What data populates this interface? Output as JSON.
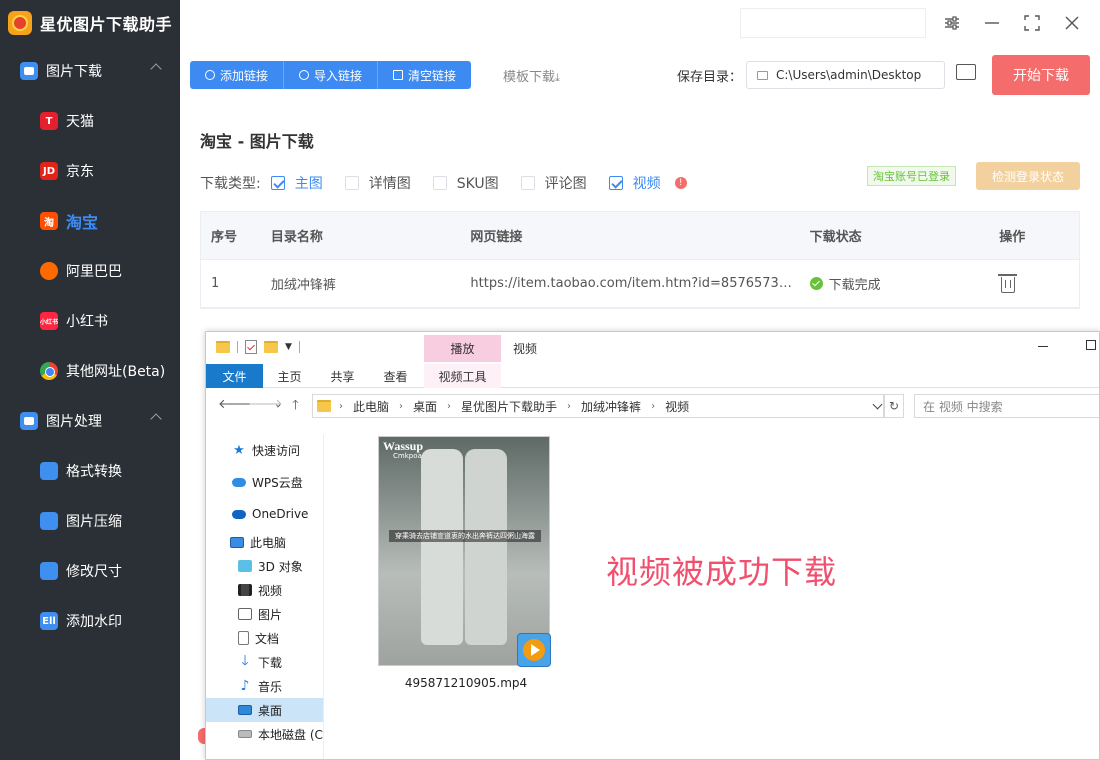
{
  "app": {
    "title": "星优图片下载助手",
    "accent": "#3d8bf2",
    "sidebar_bg": "#2b3036"
  },
  "sidebar": {
    "groups": [
      {
        "label": "图片下载",
        "items": [
          {
            "label": "天猫",
            "icon_text": "T"
          },
          {
            "label": "京东",
            "icon_text": "JD"
          },
          {
            "label": "淘宝",
            "icon_text": "淘"
          },
          {
            "label": "阿里巴巴",
            "icon_text": ""
          },
          {
            "label": "小红书",
            "icon_text": "小红书"
          },
          {
            "label": "其他网址(Beta)",
            "icon_text": ""
          }
        ]
      },
      {
        "label": "图片处理",
        "items": [
          {
            "label": "格式转换"
          },
          {
            "label": "图片压缩"
          },
          {
            "label": "修改尺寸"
          },
          {
            "label": "添加水印",
            "icon_text": "Ell"
          }
        ]
      }
    ]
  },
  "toolbar": {
    "add_link": "添加链接",
    "import_link": "导入链接",
    "clear_link": "清空链接",
    "template_download": "模板下载",
    "save_dir_label": "保存目录：",
    "save_dir_value": "C:\\Users\\admin\\Desktop",
    "start_download": "开始下载"
  },
  "content": {
    "title": "淘宝 - 图片下载",
    "type_label": "下载类型:",
    "types": [
      {
        "label": "主图",
        "checked": true
      },
      {
        "label": "详情图",
        "checked": false
      },
      {
        "label": "SKU图",
        "checked": false
      },
      {
        "label": "评论图",
        "checked": false
      },
      {
        "label": "视频",
        "checked": true
      }
    ],
    "info_mark": "!",
    "login_status": "淘宝账号已登录",
    "check_login": "检测登录状态"
  },
  "table": {
    "headers": [
      "序号",
      "目录名称",
      "网页链接",
      "下载状态",
      "操作"
    ],
    "rows": [
      {
        "index": "1",
        "dir_name": "加绒冲锋裤",
        "url": "https://item.taobao.com/item.htm?id=857657336...",
        "status": "下载完成"
      }
    ]
  },
  "explorer": {
    "play_tab": "播放",
    "window_title": "视频",
    "ribbon_tabs": [
      "文件",
      "主页",
      "共享",
      "查看",
      "视频工具"
    ],
    "breadcrumb": [
      "此电脑",
      "桌面",
      "星优图片下载助手",
      "加绒冲锋裤",
      "视频"
    ],
    "search_placeholder": "在 视频 中搜索",
    "nav": {
      "quick_access": "快速访问",
      "wps": "WPS云盘",
      "onedrive": "OneDrive",
      "this_pc": "此电脑",
      "sub": [
        "3D 对象",
        "视频",
        "图片",
        "文档",
        "下载",
        "音乐",
        "桌面",
        "本地磁盘 (C"
      ]
    },
    "file": {
      "name": "495871210905.mp4",
      "brand": "Wassup",
      "brand_sub": "Cmkpoa",
      "caption": "穿乘骑去店铺宣道衷的水出奔裤达四粥山海露"
    },
    "overlay_text": "视频被成功下载"
  }
}
